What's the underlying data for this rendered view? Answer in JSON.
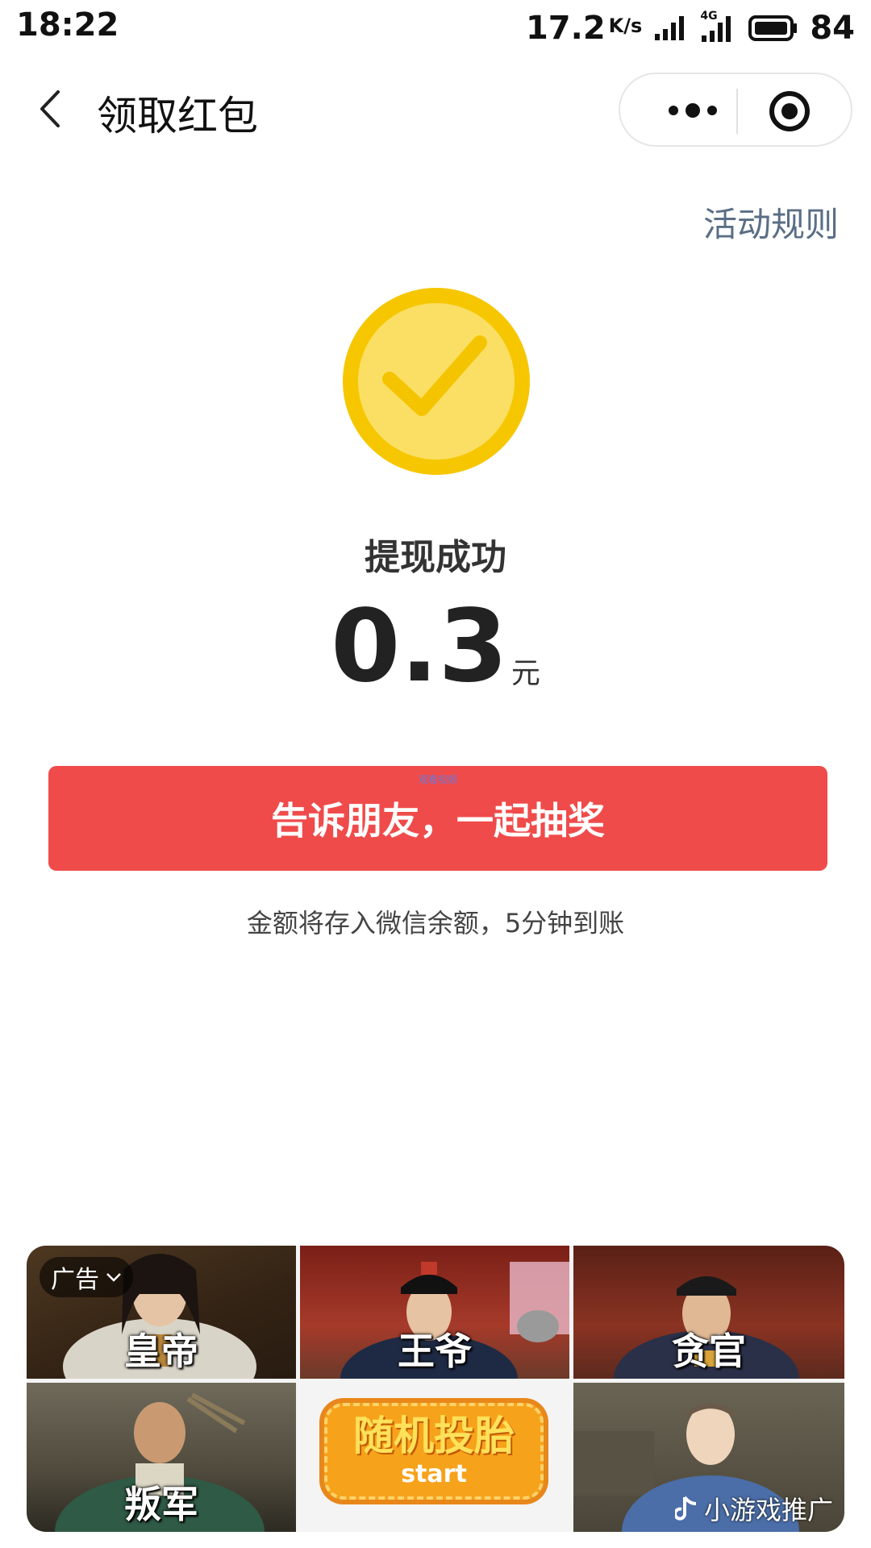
{
  "status_bar": {
    "time": "18:22",
    "net_speed": "17.2",
    "net_unit": "K/s",
    "network_type": "4G",
    "battery": "84"
  },
  "nav": {
    "title": "领取红包"
  },
  "rules_link": "活动规则",
  "result": {
    "status": "提现成功",
    "amount": "0.3",
    "unit": "元"
  },
  "share_button": {
    "label": "告诉朋友，一起抽奖",
    "watermark": "观看视频"
  },
  "note": "金额将存入微信余额，5分钟到账",
  "ad": {
    "tag": "广告",
    "tiles": [
      {
        "label": "皇帝"
      },
      {
        "label": "王爷"
      },
      {
        "label": "贪官"
      },
      {
        "label": "叛军"
      },
      {
        "start_title": "随机投胎",
        "start_sub": "start"
      },
      {
        "label": ""
      }
    ],
    "promo_label": "小游戏推广"
  },
  "colors": {
    "accent_red": "#f04b4b",
    "success_yellow": "#f6c700",
    "link_gray_blue": "#5a6e86"
  }
}
